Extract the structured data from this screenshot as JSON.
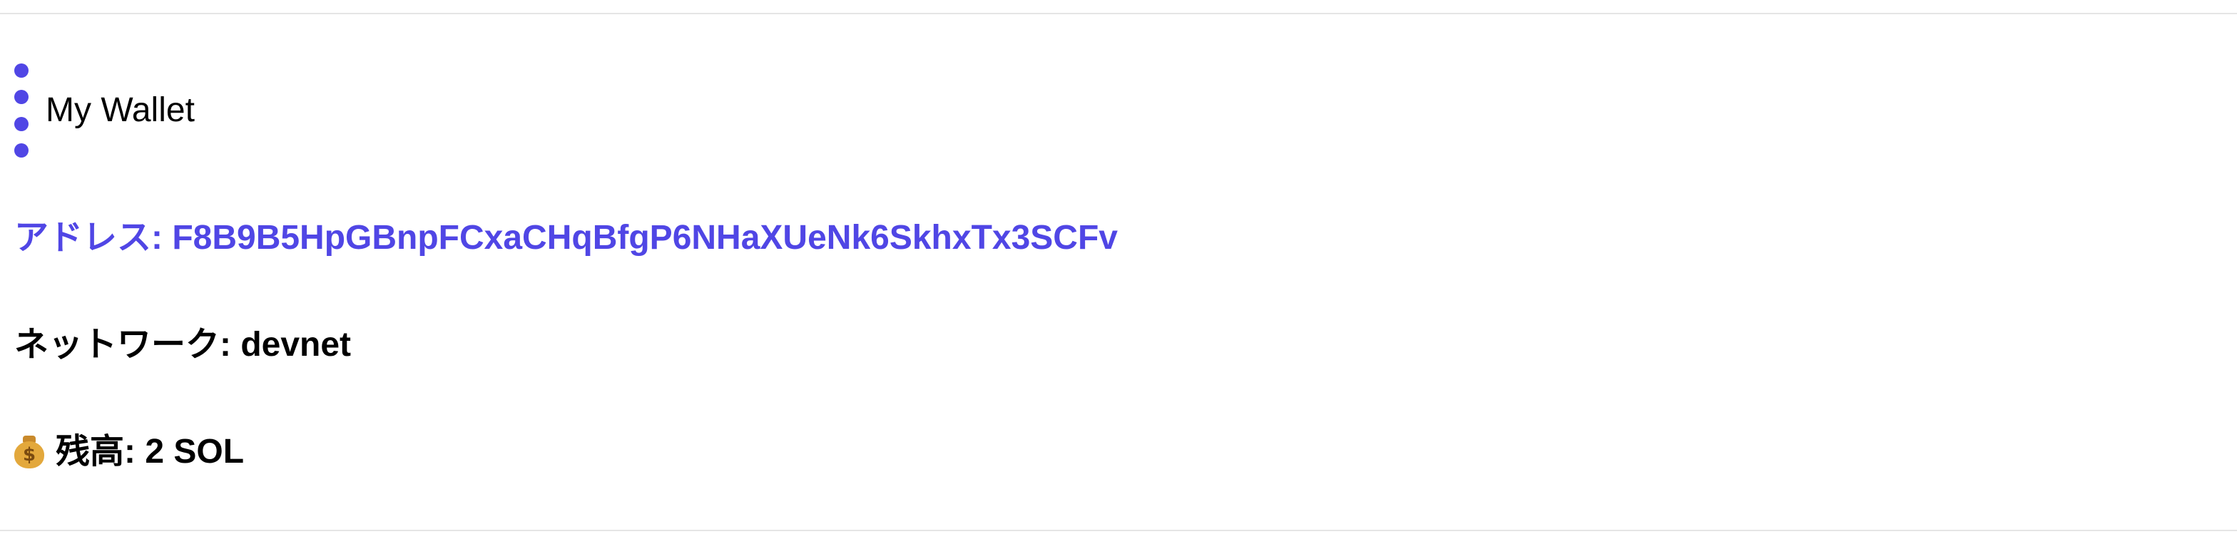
{
  "wallet": {
    "title": "My Wallet",
    "menu_icon": "vertical-dots-icon"
  },
  "address": {
    "label": "アドレス:",
    "value": "F8B9B5HpGBnpFCxaCHqBfgP6NHaXUeNk6SkhxTx3SCFv",
    "text": "アドレス: F8B9B5HpGBnpFCxaCHqBfgP6NHaXUeNk6SkhxTx3SCFv"
  },
  "network": {
    "label": "ネットワーク:",
    "value": "devnet",
    "text": "ネットワーク: devnet"
  },
  "balance": {
    "icon": "money-bag-icon",
    "label": "残高:",
    "value": "2 SOL",
    "text": "残高: 2 SOL"
  },
  "colors": {
    "accent": "#5046e5",
    "text": "#000000",
    "divider": "#e5e5e5"
  }
}
